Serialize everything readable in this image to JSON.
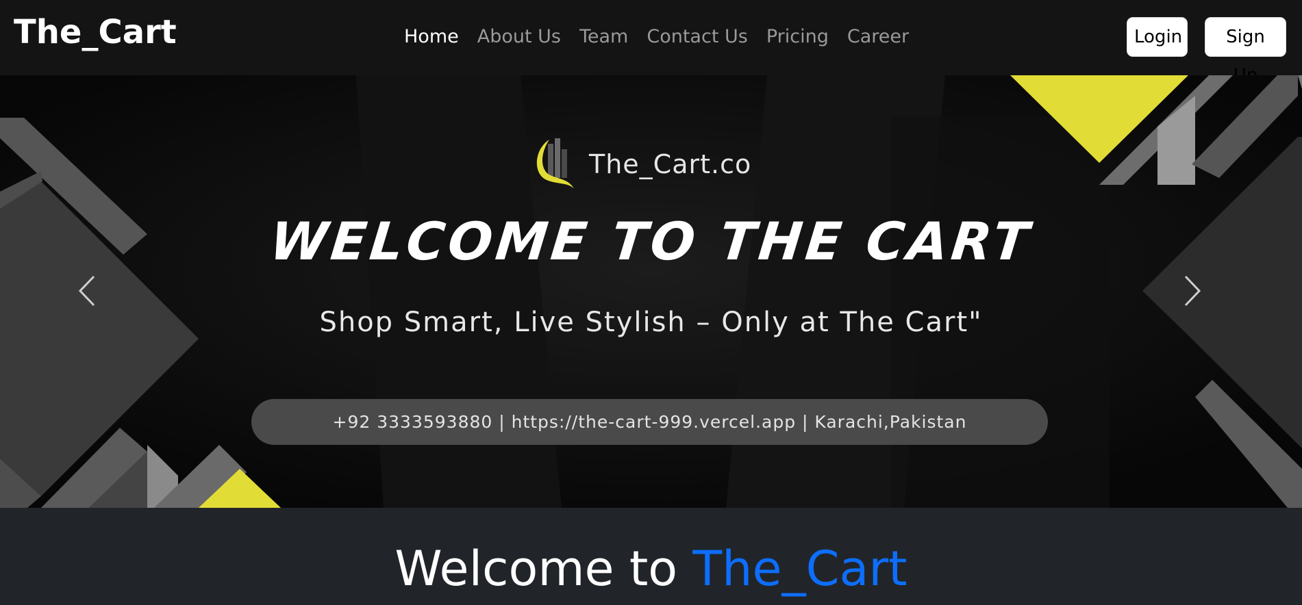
{
  "navbar": {
    "brand": "The_Cart",
    "links": [
      {
        "label": "Home",
        "active": true
      },
      {
        "label": "About Us",
        "active": false
      },
      {
        "label": "Team",
        "active": false
      },
      {
        "label": "Contact Us",
        "active": false
      },
      {
        "label": "Pricing",
        "active": false
      },
      {
        "label": "Career",
        "active": false
      }
    ],
    "login_label": "Login",
    "signup_label": "Sign Up"
  },
  "carousel": {
    "logo_text": "The_Cart.co",
    "title": "WELCOME TO THE CART",
    "subtitle": "Shop Smart, Live Stylish – Only at The Cart\"",
    "contact_line": "+92 3333593880 | https://the-cart-999.vercel.app | Karachi,Pakistan",
    "prev_icon": "chevron-left-icon",
    "next_icon": "chevron-right-icon"
  },
  "welcome": {
    "prefix": "Welcome to",
    "highlight": "The_Cart"
  },
  "colors": {
    "nav_bg": "#141414",
    "page_bg": "#212529",
    "accent_blue": "#0d6efd",
    "accent_yellow": "#e2dc37",
    "nav_link_inactive": "#9a9a9a"
  }
}
